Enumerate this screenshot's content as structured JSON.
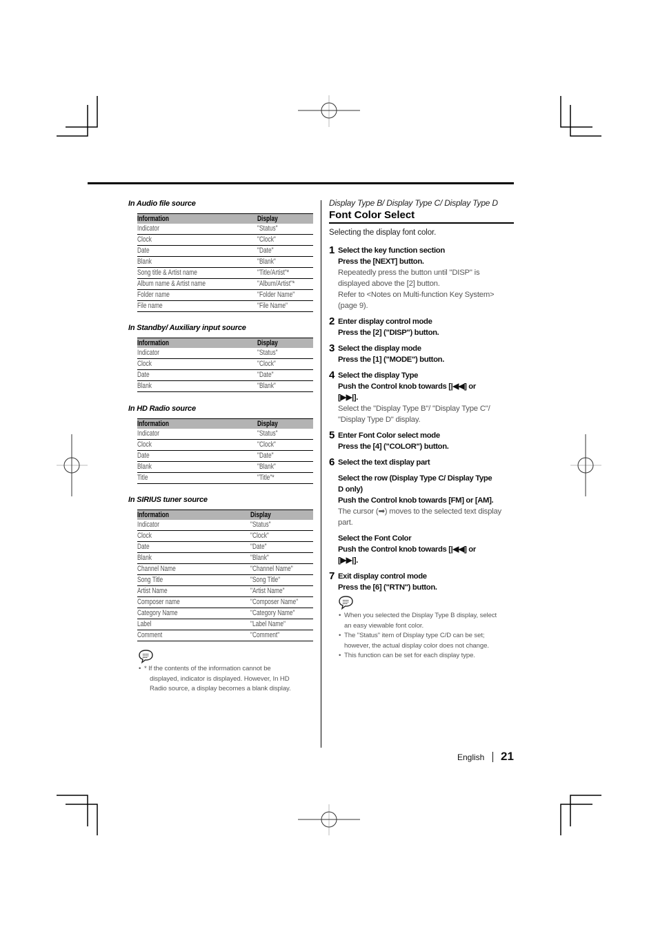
{
  "page": {
    "language": "English",
    "page_number": "21"
  },
  "left": {
    "sections": [
      {
        "heading": "In Audio file source",
        "columns": [
          "Information",
          "Display"
        ],
        "rows": [
          [
            "Indicator",
            "\"Status\""
          ],
          [
            "Clock",
            "\"Clock\""
          ],
          [
            "Date",
            "\"Date\""
          ],
          [
            "Blank",
            "\"Blank\""
          ],
          [
            "Song title & Artist name",
            "\"Title/Artist\"*"
          ],
          [
            "Album name & Artist name",
            "\"Album/Artist\"*"
          ],
          [
            "Folder name",
            "\"Folder Name\""
          ],
          [
            "File name",
            "\"File Name\""
          ]
        ]
      },
      {
        "heading": "In Standby/ Auxiliary input source",
        "columns": [
          "Information",
          "Display"
        ],
        "rows": [
          [
            "Indicator",
            "\"Status\""
          ],
          [
            "Clock",
            "\"Clock\""
          ],
          [
            "Date",
            "\"Date\""
          ],
          [
            "Blank",
            "\"Blank\""
          ]
        ]
      },
      {
        "heading": "In HD Radio source",
        "columns": [
          "Information",
          "Display"
        ],
        "rows": [
          [
            "Indicator",
            "\"Status\""
          ],
          [
            "Clock",
            "\"Clock\""
          ],
          [
            "Date",
            "\"Date\""
          ],
          [
            "Blank",
            "\"Blank\""
          ],
          [
            "Title",
            "\"Title\"*"
          ]
        ]
      },
      {
        "heading": "In SIRIUS tuner source",
        "columns": [
          "Information",
          "Display"
        ],
        "rows": [
          [
            "Indicator",
            "\"Status\""
          ],
          [
            "Clock",
            "\"Clock\""
          ],
          [
            "Date",
            "\"Date\""
          ],
          [
            "Blank",
            "\"Blank\""
          ],
          [
            "Channel Name",
            "\"Channel Name\""
          ],
          [
            "Song Title",
            "\"Song Title\""
          ],
          [
            "Artist Name",
            "\"Artist Name\""
          ],
          [
            "Composer name",
            "\"Composer Name\""
          ],
          [
            "Category Name",
            "\"Category Name\""
          ],
          [
            "Label",
            "\"Label Name\""
          ],
          [
            "Comment",
            "\"Comment\""
          ]
        ]
      }
    ],
    "note": {
      "icon": "note-icon",
      "bullet_glyph": "•",
      "bullets": [
        [
          "* If the contents of the information cannot be",
          "displayed, indicator is displayed. However, In HD",
          "Radio source, a display becomes a blank display."
        ]
      ]
    }
  },
  "right": {
    "kicker": "Display Type B/ Display Type C/ Display Type D",
    "title": "Font Color Select",
    "intro": "Selecting the display font color.",
    "steps": [
      {
        "num": "1",
        "blocks": [
          [
            {
              "t": "Select the key function section",
              "bold": true
            },
            {
              "t": "Press the [NEXT] button.",
              "bold": true
            },
            {
              "t": "Repeatedly press the button until \"DISP\" is",
              "bold": false
            },
            {
              "t": "displayed above the [2] button.",
              "bold": false
            },
            {
              "t": "Refer to <Notes on Multi-function Key System>",
              "bold": false
            },
            {
              "t": "(page 9).",
              "bold": false
            }
          ]
        ]
      },
      {
        "num": "2",
        "blocks": [
          [
            {
              "t": "Enter display control mode",
              "bold": true
            },
            {
              "t": "Press the [2] (\"DISP\") button.",
              "bold": true
            }
          ]
        ]
      },
      {
        "num": "3",
        "blocks": [
          [
            {
              "t": "Select the display mode",
              "bold": true
            },
            {
              "t": "Press the [1] (\"MODE\") button.",
              "bold": true
            }
          ]
        ]
      },
      {
        "num": "4",
        "blocks": [
          [
            {
              "t": "Select the display Type",
              "bold": true
            },
            {
              "t": "Push the Control knob towards [|◀◀] or",
              "bold": true
            },
            {
              "t": "[▶▶|].",
              "bold": true
            },
            {
              "t": "Select the \"Display Type B\"/ \"Display Type C\"/",
              "bold": false
            },
            {
              "t": "\"Display Type D\" display.",
              "bold": false
            }
          ]
        ]
      },
      {
        "num": "5",
        "blocks": [
          [
            {
              "t": "Enter Font Color select mode",
              "bold": true
            },
            {
              "t": "Press the [4] (\"COLOR\") button.",
              "bold": true
            }
          ]
        ]
      },
      {
        "num": "6",
        "blocks": [
          [
            {
              "t": "Select the text display part",
              "bold": true
            }
          ],
          [
            {
              "t": "Select the row (Display Type C/ Display Type",
              "bold": true
            },
            {
              "t": "D only)",
              "bold": true
            },
            {
              "t": "Push the Control knob towards [FM] or [AM].",
              "bold": true
            },
            {
              "t": "The cursor (➡) moves to the selected text display",
              "bold": false
            },
            {
              "t": "part.",
              "bold": false
            }
          ],
          [
            {
              "t": "Select the Font Color",
              "bold": true
            },
            {
              "t": "Push the Control knob towards [|◀◀] or",
              "bold": true
            },
            {
              "t": "[▶▶|].",
              "bold": true
            }
          ]
        ]
      },
      {
        "num": "7",
        "blocks": [
          [
            {
              "t": "Exit display control mode",
              "bold": true
            },
            {
              "t": "Press the [6] (\"RTN\") button.",
              "bold": true
            }
          ]
        ]
      }
    ],
    "note": {
      "icon": "note-icon",
      "bullet_glyph": "•",
      "bullets": [
        [
          "When you selected the Display Type B display, select",
          "an easy viewable font color."
        ],
        [
          "The \"Status\" item of Display type C/D can be set;",
          "however, the actual display color does not change."
        ],
        [
          "This function can be set for each display type."
        ]
      ]
    }
  }
}
